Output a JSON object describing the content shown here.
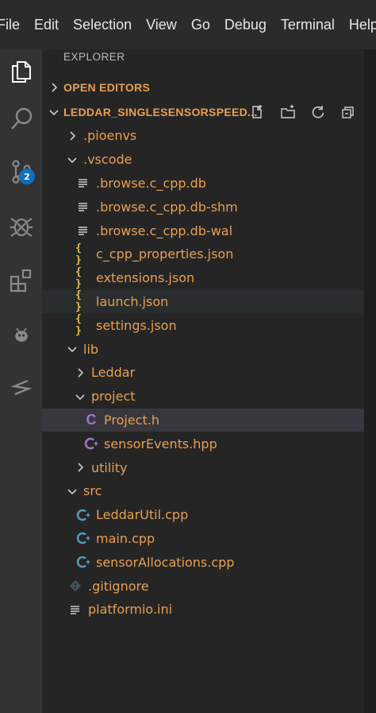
{
  "menu": [
    "File",
    "Edit",
    "Selection",
    "View",
    "Go",
    "Debug",
    "Terminal",
    "Help"
  ],
  "activity": {
    "scm_badge": "2",
    "icons": [
      "files-icon",
      "search-icon",
      "source-control-icon",
      "debug-icon",
      "extensions-icon",
      "platformio-icon",
      "remote-icon"
    ]
  },
  "sidebar": {
    "title": "EXPLORER",
    "open_editors": "OPEN EDITORS",
    "workspace": "LEDDAR_SINGLESENSORSPEED...",
    "tree": [
      {
        "label": ".pioenvs",
        "kind": "folder",
        "expanded": false,
        "depth": 0
      },
      {
        "label": ".vscode",
        "kind": "folder",
        "expanded": true,
        "depth": 0
      },
      {
        "label": ".browse.c_cpp.db",
        "kind": "lines",
        "depth": 1
      },
      {
        "label": ".browse.c_cpp.db-shm",
        "kind": "lines",
        "depth": 1
      },
      {
        "label": ".browse.c_cpp.db-wal",
        "kind": "lines",
        "depth": 1
      },
      {
        "label": "c_cpp_properties.json",
        "kind": "json",
        "depth": 1
      },
      {
        "label": "extensions.json",
        "kind": "json",
        "depth": 1
      },
      {
        "label": "launch.json",
        "kind": "json",
        "depth": 1,
        "state": "hover"
      },
      {
        "label": "settings.json",
        "kind": "json",
        "depth": 1
      },
      {
        "label": "lib",
        "kind": "folder",
        "expanded": true,
        "depth": 0
      },
      {
        "label": "Leddar",
        "kind": "folder",
        "expanded": false,
        "depth": 1
      },
      {
        "label": "project",
        "kind": "folder",
        "expanded": true,
        "depth": 1
      },
      {
        "label": "Project.h",
        "kind": "c",
        "depth": 2,
        "state": "selected"
      },
      {
        "label": "sensorEvents.hpp",
        "kind": "cpp-purple",
        "depth": 2
      },
      {
        "label": "utility",
        "kind": "folder",
        "expanded": false,
        "depth": 1
      },
      {
        "label": "src",
        "kind": "folder",
        "expanded": true,
        "depth": 0
      },
      {
        "label": "LeddarUtil.cpp",
        "kind": "cpp-blue",
        "depth": 1
      },
      {
        "label": "main.cpp",
        "kind": "cpp-blue",
        "depth": 1
      },
      {
        "label": "sensorAllocations.cpp",
        "kind": "cpp-blue",
        "depth": 1
      },
      {
        "label": ".gitignore",
        "kind": "git",
        "depth": 0
      },
      {
        "label": "platformio.ini",
        "kind": "lines",
        "depth": 0
      }
    ]
  },
  "colors": {
    "file_label": "#e8a050",
    "json_brace": "#e8c23d",
    "c_purple": "#a074c4",
    "cpp_blue": "#519aba",
    "badge": "#0e70c0"
  }
}
